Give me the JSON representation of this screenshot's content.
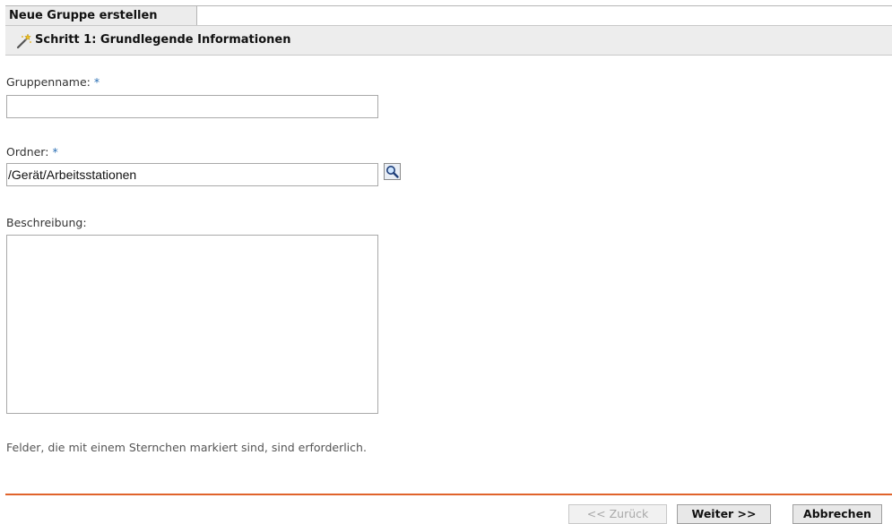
{
  "header": {
    "tab_title": "Neue Gruppe erstellen",
    "step_title": "Schritt 1: Grundlegende Informationen",
    "step_icon": "wand-icon"
  },
  "form": {
    "group_name": {
      "label": "Gruppenname:",
      "required_marker": "*",
      "value": ""
    },
    "folder": {
      "label": "Ordner:",
      "required_marker": "*",
      "value": "/Gerät/Arbeitsstationen",
      "browse_icon": "search-icon"
    },
    "description": {
      "label": "Beschreibung:",
      "value": ""
    },
    "required_hint": "Felder, die mit einem Sternchen markiert sind, sind erforderlich."
  },
  "footer": {
    "back_label": "<< Zurück",
    "next_label": "Weiter >>",
    "cancel_label": "Abbrechen",
    "divider_color": "#e0632b"
  }
}
